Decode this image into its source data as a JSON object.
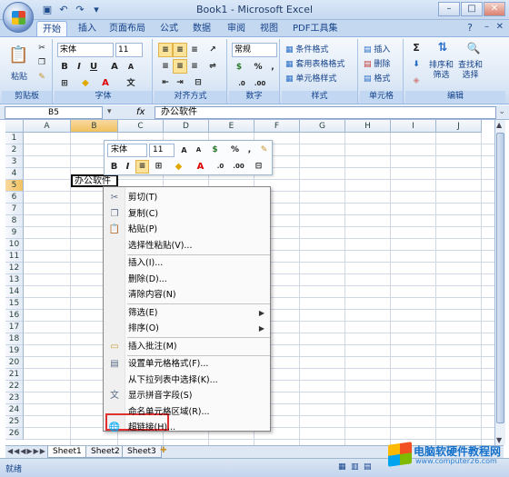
{
  "window": {
    "title": "Book1 - Microsoft Excel",
    "controls": [
      "–",
      "□",
      "✕"
    ]
  },
  "qat": {
    "icons": [
      "save-icon",
      "undo-icon",
      "redo-icon",
      "dropdown-icon"
    ]
  },
  "tabs": [
    "开始",
    "插入",
    "页面布局",
    "公式",
    "数据",
    "审阅",
    "视图",
    "PDF工具集"
  ],
  "ribbon": {
    "clipboard": {
      "label": "剪贴板",
      "paste": "粘贴"
    },
    "font": {
      "label": "字体",
      "name": "宋体",
      "size": "11"
    },
    "alignment": {
      "label": "对齐方式"
    },
    "number": {
      "label": "数字",
      "format": "常规",
      "percent": "%",
      "comma": ","
    },
    "styles": {
      "label": "样式",
      "items": [
        "条件格式",
        "套用表格格式",
        "单元格样式"
      ]
    },
    "cells": {
      "label": "单元格",
      "items": [
        "插入",
        "删除",
        "格式"
      ]
    },
    "editing": {
      "label": "编辑",
      "sort": "排序和\n筛选",
      "find": "查找和\n选择"
    }
  },
  "formula_bar": {
    "name_box": "B5",
    "fx": "fx",
    "content": "办公软件"
  },
  "grid": {
    "columns": [
      "A",
      "B",
      "C",
      "D",
      "E",
      "F",
      "G",
      "H",
      "I",
      "J"
    ],
    "rows": [
      "1",
      "2",
      "3",
      "4",
      "5",
      "6",
      "7",
      "8",
      "9",
      "10",
      "11",
      "12",
      "13",
      "14",
      "15",
      "16",
      "17",
      "18",
      "19",
      "20",
      "21",
      "22",
      "23",
      "24",
      "25",
      "26"
    ],
    "active_cell": "B5",
    "active_value": "办公软件"
  },
  "mini_toolbar": {
    "font": "宋体",
    "size": "11"
  },
  "context_menu": {
    "items": [
      {
        "label": "剪切(T)",
        "icon": "scissors-icon"
      },
      {
        "label": "复制(C)",
        "icon": "copy-icon"
      },
      {
        "label": "粘贴(P)",
        "icon": "paste-icon"
      },
      {
        "label": "选择性粘贴(V)...",
        "icon": ""
      },
      {
        "label": "插入(I)...",
        "icon": ""
      },
      {
        "label": "删除(D)...",
        "icon": ""
      },
      {
        "label": "清除内容(N)",
        "icon": ""
      },
      {
        "label": "筛选(E)",
        "icon": "",
        "submenu": true
      },
      {
        "label": "排序(O)",
        "icon": "",
        "submenu": true
      },
      {
        "label": "插入批注(M)",
        "icon": "comment-icon"
      },
      {
        "label": "设置单元格格式(F)...",
        "icon": "format-cells-icon"
      },
      {
        "label": "从下拉列表中选择(K)...",
        "icon": ""
      },
      {
        "label": "显示拼音字段(S)",
        "icon": "phonetic-icon"
      },
      {
        "label": "命名单元格区域(R)...",
        "icon": ""
      },
      {
        "label": "超链接(H)...",
        "icon": "hyperlink-icon"
      }
    ]
  },
  "sheets": [
    "Sheet1",
    "Sheet2",
    "Sheet3"
  ],
  "status": {
    "text": "就绪"
  },
  "watermark": {
    "title": "电脑软硬件教程网",
    "url": "www.computer26.com"
  }
}
